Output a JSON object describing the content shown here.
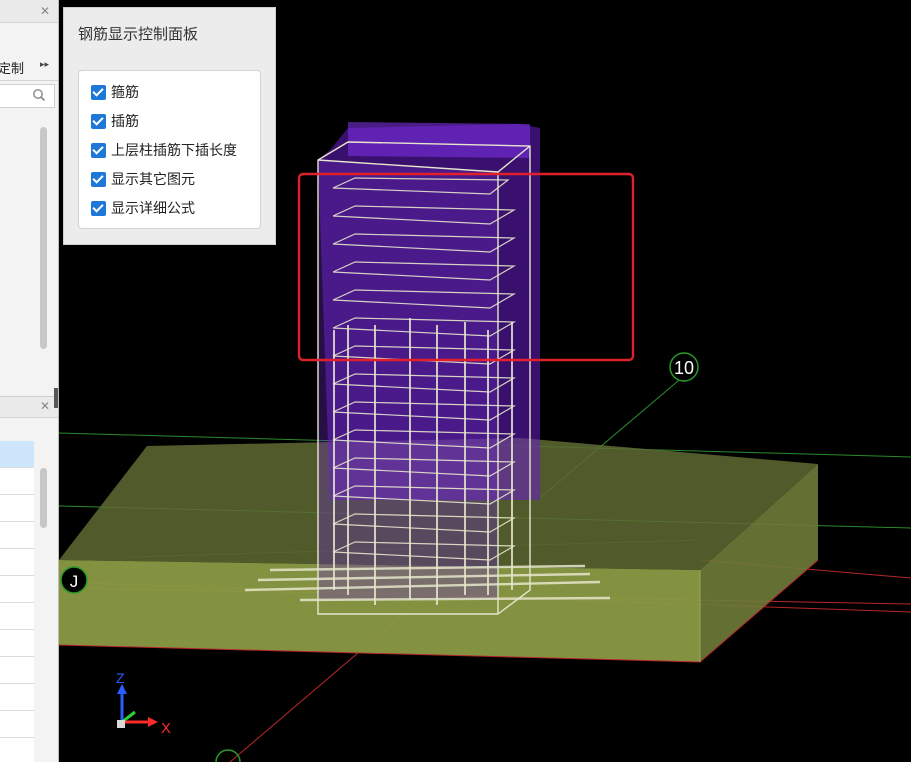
{
  "left_panel": {
    "toolbar_label": "定制",
    "search_placeholder": ""
  },
  "control_panel": {
    "title": "钢筋显示控制面板",
    "options": [
      {
        "label": "箍筋",
        "checked": true
      },
      {
        "label": "插筋",
        "checked": true
      },
      {
        "label": "上层柱插筋下插长度",
        "checked": true
      },
      {
        "label": "显示其它图元",
        "checked": true
      },
      {
        "label": "显示详细公式",
        "checked": true
      }
    ]
  },
  "viewport": {
    "axis_labels": {
      "x": "X",
      "y": "",
      "z": "Z"
    },
    "grid_marker_number": "10",
    "grid_marker_letter": "J",
    "colors": {
      "highlight_box": "#e0202a",
      "column_fill": "#6a1ec8",
      "footing_fill": "#8a9a45",
      "grid_green": "#2b9a2b",
      "grid_red": "#c0282a",
      "rebar": "#e6e6cc"
    }
  }
}
